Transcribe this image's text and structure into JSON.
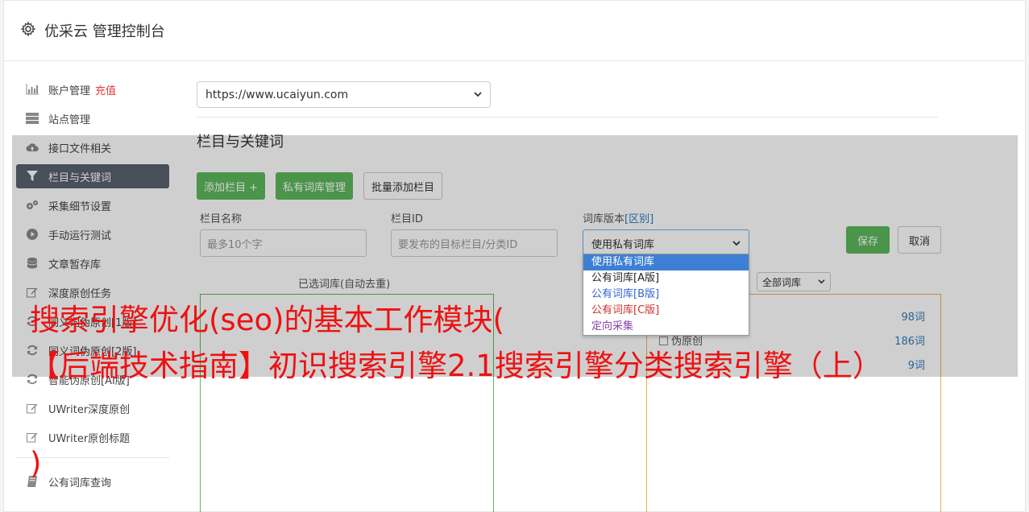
{
  "header": {
    "title": "优采云 管理控制台"
  },
  "sidebar": {
    "items": [
      {
        "label": "账户管理",
        "extra": "充值",
        "icon": "bar-chart-icon"
      },
      {
        "label": "站点管理",
        "icon": "server-icon"
      },
      {
        "label": "接口文件相关",
        "icon": "cloud-upload-icon"
      },
      {
        "label": "栏目与关键词",
        "icon": "filter-icon",
        "active": true
      },
      {
        "label": "采集细节设置",
        "icon": "gears-icon"
      },
      {
        "label": "手动运行测试",
        "icon": "play-icon"
      },
      {
        "label": "文章暂存库",
        "icon": "database-icon"
      },
      {
        "label": "深度原创任务",
        "icon": "edit-icon"
      },
      {
        "label": "同义词伪原创[1版]",
        "icon": "refresh-icon"
      },
      {
        "label": "同义词伪原创[2版]",
        "icon": "refresh-icon"
      },
      {
        "label": "智能伪原创[AI版]",
        "icon": "refresh-icon"
      },
      {
        "label": "UWriter深度原创",
        "icon": "edit-icon"
      },
      {
        "label": "UWriter原创标题",
        "icon": "edit-icon"
      },
      {
        "label": "公有词库查询",
        "icon": "book-icon"
      }
    ]
  },
  "main": {
    "site_select": "https://www.ucaiyun.com",
    "section_title": "栏目与关键词",
    "buttons": {
      "add_column": "添加栏目 +",
      "private_lib": "私有词库管理",
      "batch_add": "批量添加栏目",
      "save": "保存",
      "cancel": "取消"
    },
    "form": {
      "name_label": "栏目名称",
      "name_placeholder": "最多10个字",
      "id_label": "栏目ID",
      "id_placeholder": "要发布的目标栏目/分类ID",
      "version_label": "词库版本",
      "version_link": "[区别]",
      "version_value": "使用私有词库"
    },
    "dropdown_options": [
      "使用私有词库",
      "公有词库[A版]",
      "公有词库[B版]",
      "公有词库[C版]",
      "定向采集"
    ],
    "selected_label": "已选词库(自动去重)",
    "all_lib": "全部词库",
    "lib_rows": [
      {
        "label": "",
        "count": "98词"
      },
      {
        "label": "伪原创",
        "count": "186词"
      },
      {
        "label": "",
        "count": "9词"
      }
    ]
  },
  "overlay_text": {
    "line1": "搜索引擎优化(seo)的基本工作模块(",
    "line2": "【后端技术指南】初识搜索引擎2.1搜索引擎分类搜索引擎（上）",
    "line3": ")"
  }
}
